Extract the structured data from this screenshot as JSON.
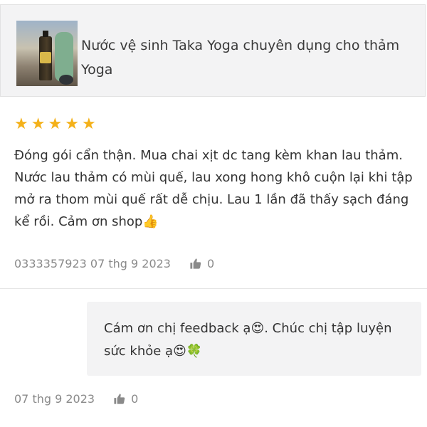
{
  "product": {
    "title": "Nước vệ sinh Taka Yoga chuyên dụng cho thảm Yoga",
    "thumbnail_icon": "product-thumbnail-image"
  },
  "review": {
    "rating": 5,
    "rating_max": 5,
    "text": "Đóng gói cẩn thận. Mua chai xịt dc tang kèm khan lau thảm. Nước lau thảm có mùi quế, lau xong hong khô cuộn lại khi tập mở ra thom mùi quế rất dễ chịu. Lau 1 lần đã thấy sạch đáng kể rồi. Cảm ơn shop",
    "text_emoji": "👍",
    "author": "0333357923",
    "date": "07 thg 9 2023",
    "likes": "0",
    "like_icon": "thumbs-up-icon",
    "star_color": "#f4b11a"
  },
  "reply": {
    "part1": "Cám ơn chị feedback ạ",
    "emoji1": "😍",
    "part2": ". Chúc chị tập luyện sức khỏe ạ",
    "emoji2": "😍",
    "emoji3": "🍀",
    "date": "07 thg 9 2023",
    "likes": "0",
    "like_icon": "thumbs-up-icon"
  }
}
